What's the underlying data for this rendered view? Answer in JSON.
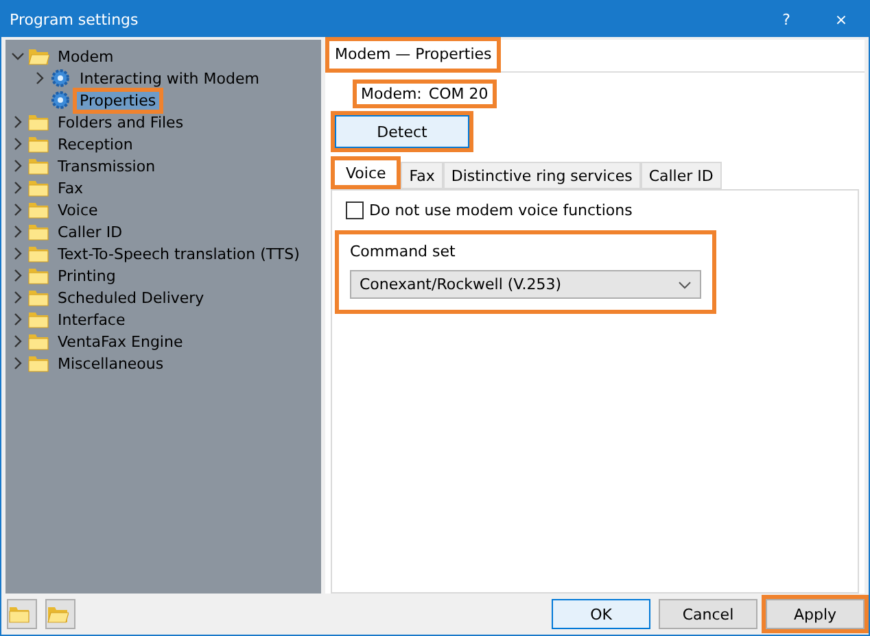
{
  "window": {
    "title": "Program settings",
    "help_button": "?",
    "close_button": "×"
  },
  "tree": [
    {
      "label": "Modem",
      "kind": "folder",
      "expanded": true,
      "selected": false,
      "highlighted": false,
      "children": [
        {
          "label": "Interacting with Modem",
          "kind": "gear",
          "expanded": false,
          "selected": false,
          "highlighted": false
        },
        {
          "label": "Properties",
          "kind": "gear",
          "selected": true,
          "highlighted": true
        }
      ]
    },
    {
      "label": "Folders and Files",
      "kind": "folder",
      "expanded": false,
      "selected": false,
      "highlighted": false
    },
    {
      "label": "Reception",
      "kind": "folder",
      "expanded": false,
      "selected": false,
      "highlighted": false
    },
    {
      "label": "Transmission",
      "kind": "folder",
      "expanded": false,
      "selected": false,
      "highlighted": false
    },
    {
      "label": "Fax",
      "kind": "folder",
      "expanded": false,
      "selected": false,
      "highlighted": false
    },
    {
      "label": "Voice",
      "kind": "folder",
      "expanded": false,
      "selected": false,
      "highlighted": false
    },
    {
      "label": "Caller ID",
      "kind": "folder",
      "expanded": false,
      "selected": false,
      "highlighted": false
    },
    {
      "label": "Text-To-Speech translation (TTS)",
      "kind": "folder",
      "expanded": false,
      "selected": false,
      "highlighted": false
    },
    {
      "label": "Printing",
      "kind": "folder",
      "expanded": false,
      "selected": false,
      "highlighted": false
    },
    {
      "label": "Scheduled Delivery",
      "kind": "folder",
      "expanded": false,
      "selected": false,
      "highlighted": false
    },
    {
      "label": "Interface",
      "kind": "folder",
      "expanded": false,
      "selected": false,
      "highlighted": false
    },
    {
      "label": "VentaFax Engine",
      "kind": "folder",
      "expanded": false,
      "selected": false,
      "highlighted": false
    },
    {
      "label": "Miscellaneous",
      "kind": "folder",
      "expanded": false,
      "selected": false,
      "highlighted": false
    }
  ],
  "panel": {
    "header": {
      "text": "Modem — Properties",
      "highlighted": true
    },
    "modem": {
      "label": "Modem:",
      "value": "COM 20",
      "highlighted": true
    },
    "detect_button": {
      "label": "Detect",
      "highlighted": true
    },
    "tabs": [
      {
        "label": "Voice",
        "selected": true,
        "highlighted": true
      },
      {
        "label": "Fax",
        "selected": false,
        "highlighted": false
      },
      {
        "label": "Distinctive ring services",
        "selected": false,
        "highlighted": false
      },
      {
        "label": "Caller ID",
        "selected": false,
        "highlighted": false
      }
    ],
    "voice_checkbox": {
      "label": "Do not use modem voice functions",
      "checked": false
    },
    "command_set": {
      "label": "Command set",
      "value": "Conexant/Rockwell (V.253)",
      "highlighted": true
    }
  },
  "footer": {
    "buttons": [
      {
        "label": "OK",
        "default": true,
        "highlighted": false
      },
      {
        "label": "Cancel",
        "default": false,
        "highlighted": false
      },
      {
        "label": "Apply",
        "default": false,
        "highlighted": true
      }
    ]
  }
}
